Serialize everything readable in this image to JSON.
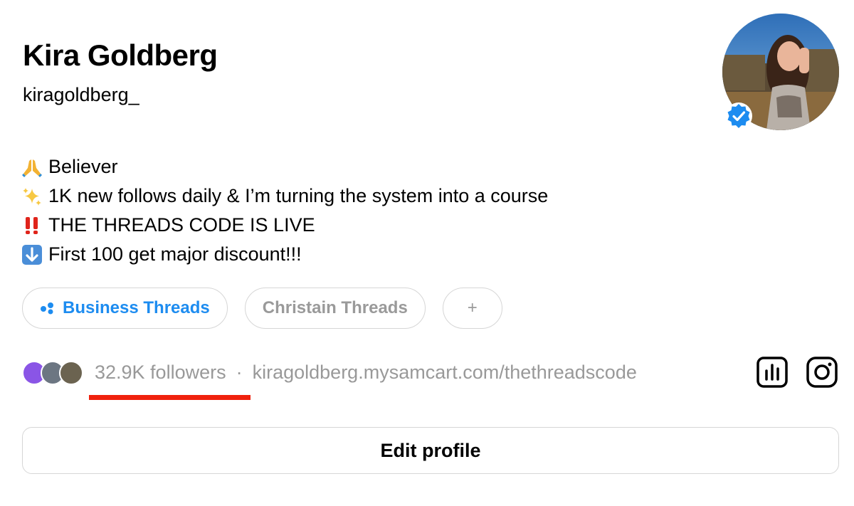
{
  "profile": {
    "name": "Kira Goldberg",
    "handle": "kiragoldberg_",
    "verified": true
  },
  "bio": {
    "lines": [
      {
        "icon": "folded-hands-emoji",
        "text": "Believer"
      },
      {
        "icon": "sparkles-emoji",
        "text": "1K new follows daily & I’m turning the system into a course"
      },
      {
        "icon": "double-exclamation-emoji",
        "text": "THE THREADS CODE IS LIVE"
      },
      {
        "icon": "down-arrow-emoji",
        "text": "First 100 get major discount!!!"
      }
    ]
  },
  "tags": [
    {
      "label": "Business Threads",
      "active": true,
      "icon": "dots-icon"
    },
    {
      "label": "Christain Threads",
      "active": false
    },
    {
      "label": "+",
      "active": false
    }
  ],
  "stats": {
    "followers": "32.9K followers",
    "separator": "·",
    "link": "kiragoldberg.mysamcart.com/thethreadscode"
  },
  "actions": {
    "edit_profile": "Edit profile"
  },
  "colors": {
    "accent_blue": "#1d8cf0",
    "muted_text": "#999999",
    "annotation_red": "#f0210d",
    "border": "#d6d6d6"
  }
}
